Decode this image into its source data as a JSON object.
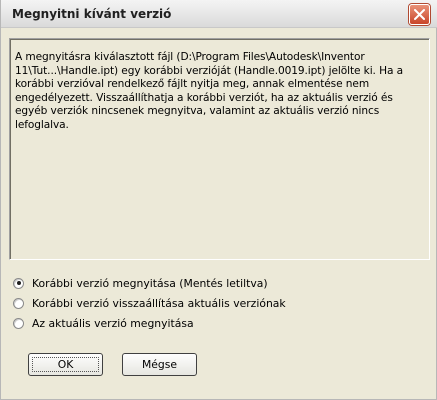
{
  "dialog": {
    "title": "Megnyitni kívánt verzió",
    "close_icon": "close-icon",
    "message": "A megnyitásra kiválasztott fájl (D:\\Program Files\\Autodesk\\Inventor 11\\Tut...\\Handle.ipt) egy korábbi verzióját (Handle.0019.ipt) jelölte ki. Ha a korábbi verzióval rendelkező fájlt nyitja meg, annak elmentése nem engedélyezett. Visszaállíthatja a korábbi verziót, ha az aktuális verzió és egyéb verziók nincsenek megnyitva, valamint az aktuális verzió nincs lefoglalva.",
    "options": [
      {
        "label": "Korábbi verzió megnyitása (Mentés letiltva)",
        "selected": true
      },
      {
        "label": "Korábbi verzió visszaállítása aktuális verziónak",
        "selected": false
      },
      {
        "label": "Az aktuális verzió megnyitása",
        "selected": false
      }
    ],
    "buttons": {
      "ok": "OK",
      "cancel": "Mégse"
    }
  },
  "colors": {
    "window_bg": "#ece9d8",
    "close_button": "#c9452a"
  }
}
